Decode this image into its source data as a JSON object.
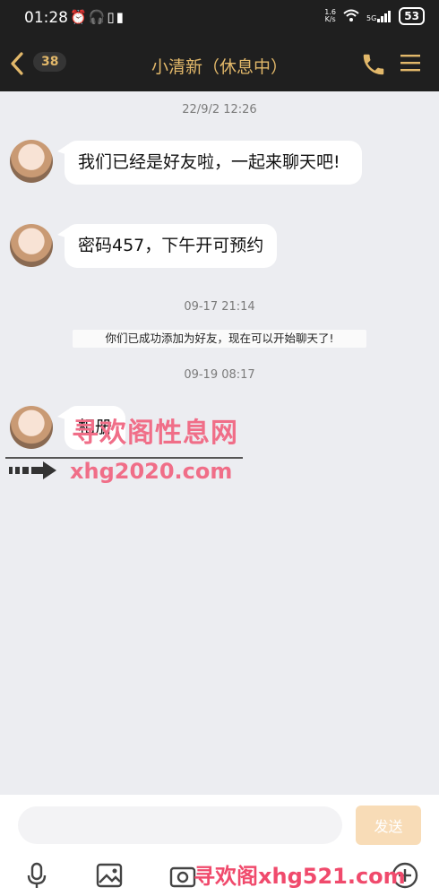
{
  "status_bar": {
    "time": "01:28",
    "left_icons": [
      "alarm-icon",
      "headphones-icon",
      "battery-saver-icon",
      "vibrate-icon"
    ],
    "net_speed": "1.6\nK/s",
    "network": "5G",
    "battery": "53"
  },
  "header": {
    "unread_count": "38",
    "title": "小清新（休息中）"
  },
  "messages": [
    {
      "time": "22/9/2 12:26",
      "text": "我们已经是好友啦，一起来聊天吧!"
    },
    {
      "text": "密码457，下午开可预约"
    },
    {
      "time": "09-17 21:14",
      "notice": "你们已成功添加为好友，现在可以开始聊天了!"
    },
    {
      "time": "09-19 08:17",
      "text": "相册"
    }
  ],
  "watermarks": {
    "line1": "寻欢阁性息网",
    "line2": "xhg2020.com",
    "line3": "寻欢阁xhg521.com"
  },
  "composer": {
    "placeholder": "",
    "send_label": "发送"
  },
  "toolbar": [
    "microphone-icon",
    "image-icon",
    "camera-icon",
    "add-icon"
  ],
  "colors": {
    "header_bg": "#1f1f1f",
    "accent": "#e2b86a",
    "chat_bg": "#ecedf1",
    "send_button_bg": "#f8dcb7",
    "watermark": "#f06e88"
  }
}
